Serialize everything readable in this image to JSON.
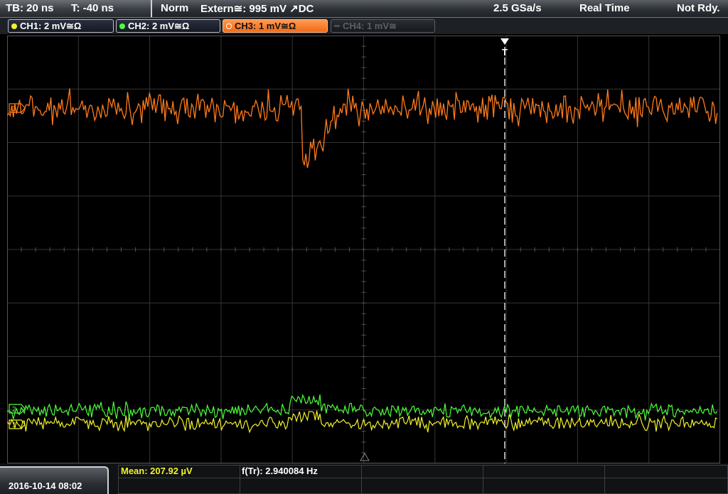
{
  "header": {
    "timebase": "TB: 20 ns",
    "trigger_time": "T: -40 ns",
    "trigger_mode": "Norm",
    "trigger_source": "Extern≅: 995 mV ↗DC",
    "sample_rate": "2.5 GSa/s",
    "acq_mode": "Real Time",
    "status": "Not Rdy."
  },
  "channels": [
    {
      "label": "CH1: 2 mV≅Ω",
      "color": "#f2f22c",
      "state": "on"
    },
    {
      "label": "CH2: 2 mV≅Ω",
      "color": "#4cff3a",
      "state": "on"
    },
    {
      "label": "CH3: 1 mV≅Ω",
      "color": "#ff7a1a",
      "state": "active"
    },
    {
      "label": "CH4: 1 mV≅",
      "color": "#5b5f66",
      "state": "off"
    }
  ],
  "markers": {
    "ch3": "3",
    "ch2": "2",
    "ch1": "1",
    "trigger": "T"
  },
  "footer": {
    "datetime": "2016-10-14 08:02",
    "mean": "Mean: 207.92 µV",
    "freq": "f(Tr): 2.940084 Hz"
  },
  "colors": {
    "ch1": "#f2f22c",
    "ch2": "#4cff3a",
    "ch3": "#ff7a1a",
    "grid": "#3a3a3a",
    "trigger_line": "#ffffff"
  }
}
